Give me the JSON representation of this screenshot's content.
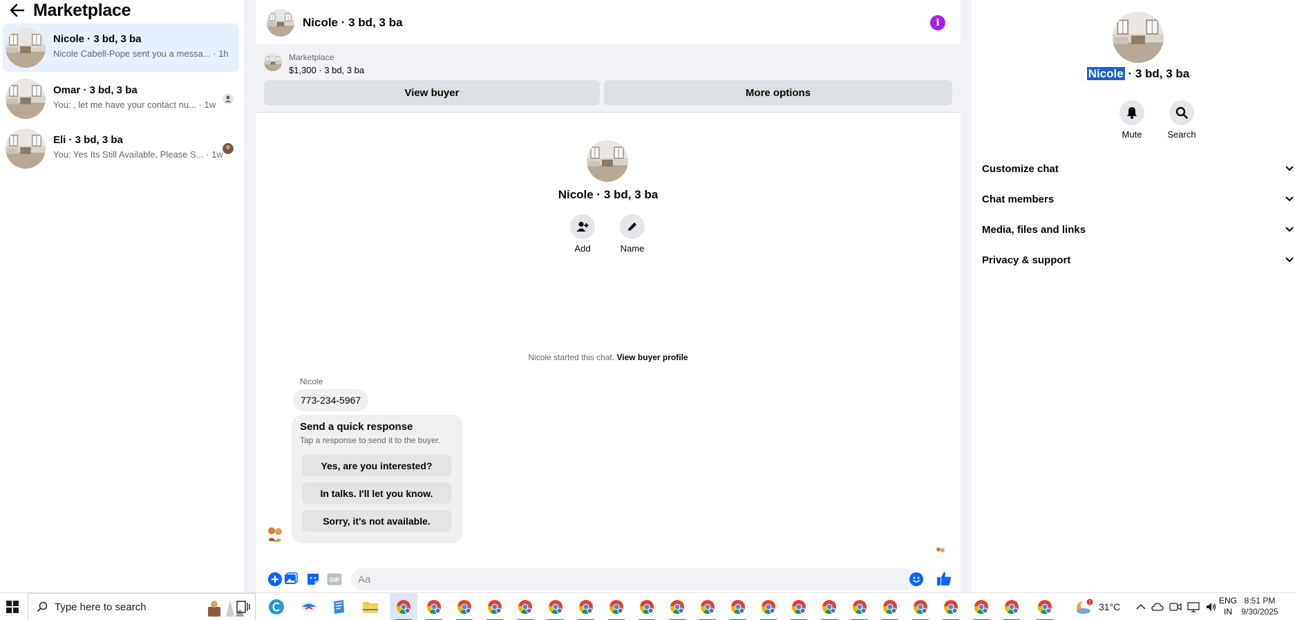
{
  "colors": {
    "accent": "#0866ff",
    "info_badge": "#a020f0",
    "active_row": "#e7f0fd",
    "selection": "#1c5fd6"
  },
  "sidebar": {
    "title": "Marketplace",
    "conversations": [
      {
        "name": "Nicole · 3 bd, 3 ba",
        "preview": "Nicole Cabell-Pope sent you a messa... · 1h",
        "active": true
      },
      {
        "name": "Omar · 3 bd, 3 ba",
        "preview": "You: , let me have your contact nu... · 1w",
        "active": false
      },
      {
        "name": "Eli · 3 bd, 3 ba",
        "preview": "You: Yes Its Still Available, Please S... · 1w",
        "active": false
      }
    ]
  },
  "chat": {
    "header_name": "Nicole · 3 bd, 3 ba",
    "info_icon": "i",
    "marketplace": {
      "label": "Marketplace",
      "price_line": "$1,300 · 3 bd, 3 ba"
    },
    "buttons": {
      "view_buyer": "View buyer",
      "more_options": "More options"
    },
    "intro": {
      "name": "Nicole · 3 bd, 3 ba",
      "add_label": "Add",
      "name_label": "Name"
    },
    "started_text": "Nicole started this chat.",
    "started_link": "View buyer profile",
    "sender_name": "Nicole",
    "message": "773-234-5967",
    "quick_response": {
      "title": "Send a quick response",
      "subtitle": "Tap a response to send it to the buyer.",
      "options": [
        "Yes, are you interested?",
        "In talks. I'll let you know.",
        "Sorry, it's not available."
      ]
    },
    "composer": {
      "placeholder": "Aa",
      "gif_label": "GIF"
    }
  },
  "right_panel": {
    "name_highlight": "Nicole",
    "name_rest": " · 3 bd, 3 ba",
    "actions": {
      "mute": "Mute",
      "search": "Search"
    },
    "sections": [
      "Customize chat",
      "Chat members",
      "Media, files and links",
      "Privacy & support"
    ]
  },
  "taskbar": {
    "search_placeholder": "Type here to search",
    "weather_temp": "31°C",
    "weather_badge": "1",
    "lang_line1": "ENG",
    "lang_line2": "IN",
    "time": "8:51 PM",
    "date": "9/30/2025"
  }
}
